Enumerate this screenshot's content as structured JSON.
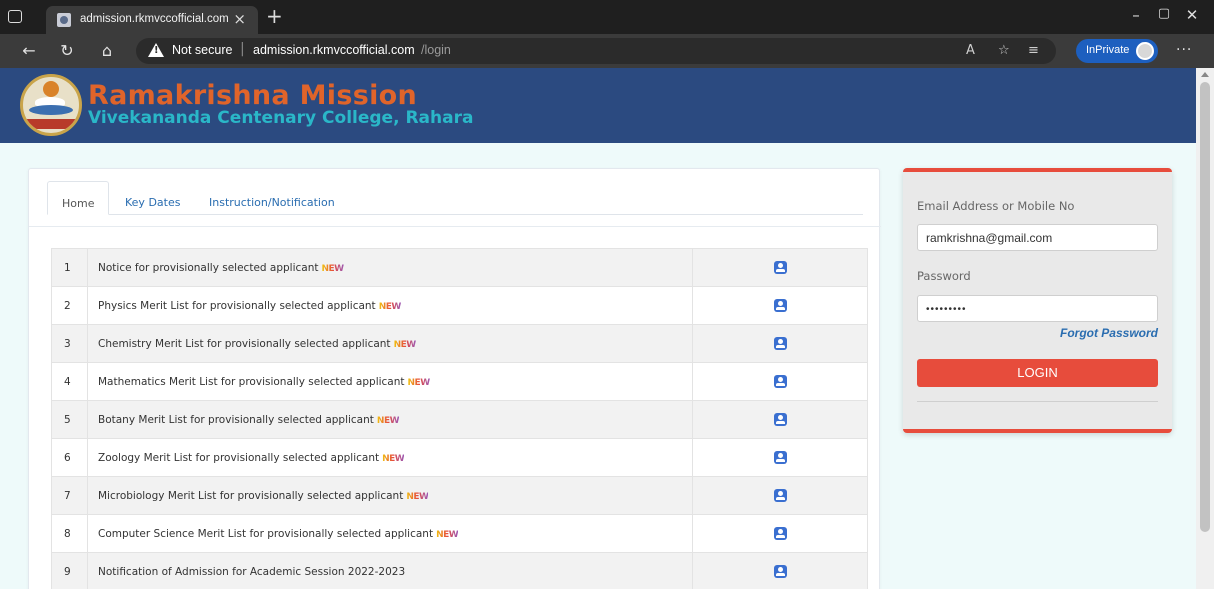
{
  "browser": {
    "tab_title": "admission.rkmvccofficial.com",
    "tab_close": "×",
    "new_tab": "+",
    "security_label": "Not secure",
    "url_domain": "admission.rkmvccofficial.com",
    "url_path": "/login",
    "inprivate_label": "InPrivate",
    "more": "···"
  },
  "site": {
    "title": "Ramakrishna Mission",
    "subtitle": "Vivekananda Centenary College, Rahara"
  },
  "tabs": [
    {
      "label": "Home"
    },
    {
      "label": "Key Dates"
    },
    {
      "label": "Instruction/Notification"
    }
  ],
  "new_label": "NEW",
  "notices": [
    {
      "num": "1",
      "title": "Notice for provisionally selected applicant",
      "is_new": true
    },
    {
      "num": "2",
      "title": "Physics Merit List for provisionally selected applicant",
      "is_new": true
    },
    {
      "num": "3",
      "title": "Chemistry Merit List for provisionally selected applicant",
      "is_new": true
    },
    {
      "num": "4",
      "title": "Mathematics Merit List for provisionally selected applicant",
      "is_new": true
    },
    {
      "num": "5",
      "title": "Botany Merit List for provisionally selected applicant",
      "is_new": true
    },
    {
      "num": "6",
      "title": "Zoology Merit List for provisionally selected applicant",
      "is_new": true
    },
    {
      "num": "7",
      "title": "Microbiology Merit List for provisionally selected applicant",
      "is_new": true
    },
    {
      "num": "8",
      "title": "Computer Science Merit List for provisionally selected applicant",
      "is_new": true
    },
    {
      "num": "9",
      "title": "Notification of Admission for Academic Session 2022-2023",
      "is_new": false
    }
  ],
  "login": {
    "email_label": "Email Address or Mobile No",
    "email_value": "ramkrishna@gmail.com",
    "password_label": "Password",
    "password_value": "•••••••••",
    "forgot_label": "Forgot Password",
    "button_label": "LOGIN"
  },
  "colors": {
    "header_bg": "#2b4a80",
    "title_color": "#e0642a",
    "subtitle_color": "#2ab7c8",
    "accent_red": "#e74c3c",
    "link_blue": "#2a6db0",
    "inprivate_blue": "#1d5fbf"
  }
}
